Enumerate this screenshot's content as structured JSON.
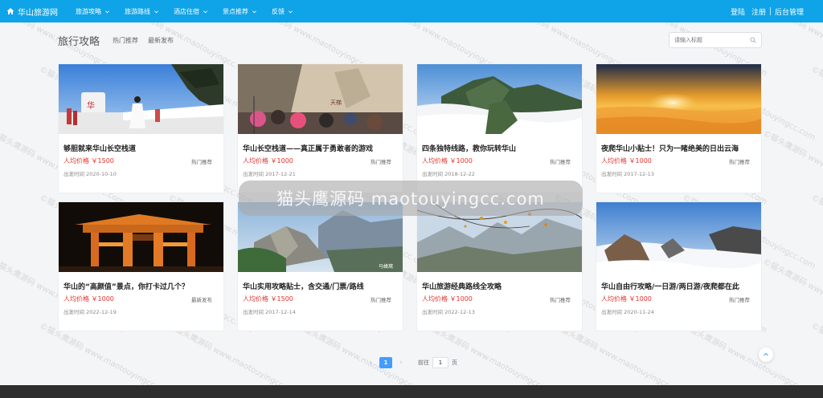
{
  "header": {
    "brand": "华山旅游网",
    "nav": [
      "旅游攻略",
      "旅游路线",
      "酒店住宿",
      "景点推荐",
      "反馈"
    ],
    "login": "登陆",
    "register": "注册",
    "admin": "后台管理",
    "bg_color": "#0fa3e8"
  },
  "subheader": {
    "title": "旅行攻略",
    "tabs": [
      "热门推荐",
      "最新发布"
    ],
    "search_placeholder": "请输入标题"
  },
  "cards": [
    {
      "title": "够胆就来华山长空栈道",
      "price": "人均价格 ￥1500",
      "tag": "热门推荐",
      "date": "出发时间 2020-10-10"
    },
    {
      "title": "华山长空栈道——真正属于勇敢者的游戏",
      "price": "人均价格 ￥1000",
      "tag": "热门推荐",
      "date": "出发时间 2017-12-21"
    },
    {
      "title": "四条独特线路，教你玩转华山",
      "price": "人均价格 ￥1000",
      "tag": "热门推荐",
      "date": "出发时间 2018-12-22"
    },
    {
      "title": "夜爬华山小贴士！只为一睹绝美的日出云海",
      "price": "人均价格 ￥1000",
      "tag": "热门推荐",
      "date": "出发时间 2017-12-13"
    },
    {
      "title": "华山的“高颜值”景点，你打卡过几个？",
      "price": "人均价格 ￥1000",
      "tag": "最新发布",
      "date": "出发时间 2022-12-19"
    },
    {
      "title": "华山实用攻略贴士，含交通/门票/路线",
      "price": "人均价格 ￥1500",
      "tag": "热门推荐",
      "date": "出发时间 2017-12-14"
    },
    {
      "title": "华山旅游经典路线全攻略",
      "price": "人均价格 ￥1000",
      "tag": "热门推荐",
      "date": "出发时间 2022-12-13"
    },
    {
      "title": "华山自由行攻略/一日游/两日游/夜爬都在此",
      "price": "人均价格 ￥1000",
      "tag": "热门推荐",
      "date": "出发时间 2020-11-24"
    }
  ],
  "overlay_text": "猫头鹰源码 maotouyingcc.com",
  "watermark": "©猫头鹰源码 www.maotouyingcc.com",
  "pagination": {
    "current": "1",
    "goto_prefix": "前往",
    "goto_value": "1",
    "goto_suffix": "页"
  },
  "colors": {
    "accent": "#409eff",
    "price": "#e4322b"
  }
}
